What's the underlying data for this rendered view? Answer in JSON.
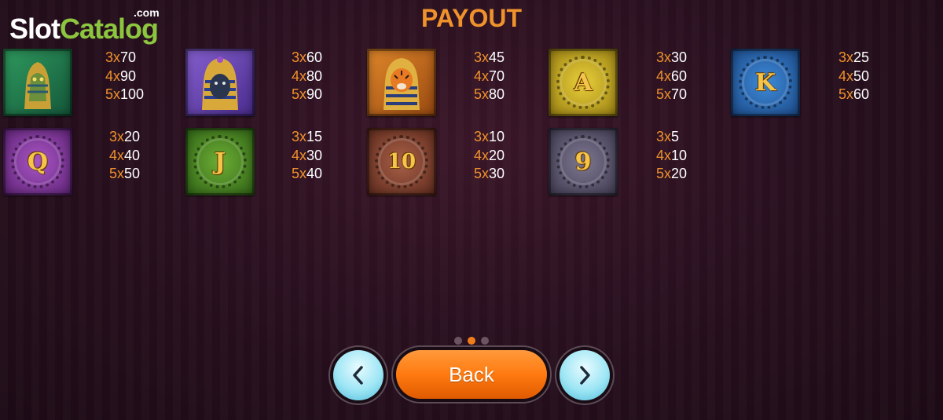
{
  "logo": {
    "slot": "Slot",
    "catalog": "Catalog",
    "com": ".com"
  },
  "title": "PAYOUT",
  "symbols": [
    {
      "name": "reptile-god",
      "letter": "",
      "color": "#1f7a4a",
      "pays": [
        [
          "3x",
          "70"
        ],
        [
          "4x",
          "90"
        ],
        [
          "5x",
          "100"
        ]
      ]
    },
    {
      "name": "gorilla-pharaoh",
      "letter": "",
      "color": "#6a3fb0",
      "pays": [
        [
          "3x",
          "60"
        ],
        [
          "4x",
          "80"
        ],
        [
          "5x",
          "90"
        ]
      ]
    },
    {
      "name": "tiger-pharaoh",
      "letter": "",
      "color": "#c46a1c",
      "pays": [
        [
          "3x",
          "45"
        ],
        [
          "4x",
          "70"
        ],
        [
          "5x",
          "80"
        ]
      ]
    },
    {
      "name": "a",
      "letter": "A",
      "color": "#c8a81f",
      "pays": [
        [
          "3x",
          "30"
        ],
        [
          "4x",
          "60"
        ],
        [
          "5x",
          "70"
        ]
      ]
    },
    {
      "name": "k",
      "letter": "K",
      "color": "#2c6db4",
      "pays": [
        [
          "3x",
          "25"
        ],
        [
          "4x",
          "50"
        ],
        [
          "5x",
          "60"
        ]
      ]
    },
    {
      "name": "q",
      "letter": "Q",
      "color": "#8a3da0",
      "pays": [
        [
          "3x",
          "20"
        ],
        [
          "4x",
          "40"
        ],
        [
          "5x",
          "50"
        ]
      ]
    },
    {
      "name": "j",
      "letter": "J",
      "color": "#4f8f24",
      "pays": [
        [
          "3x",
          "15"
        ],
        [
          "4x",
          "30"
        ],
        [
          "5x",
          "40"
        ]
      ]
    },
    {
      "name": "10",
      "letter": "10",
      "color": "#8a4a34",
      "pays": [
        [
          "3x",
          "10"
        ],
        [
          "4x",
          "20"
        ],
        [
          "5x",
          "30"
        ]
      ]
    },
    {
      "name": "9",
      "letter": "9",
      "color": "#5e5870",
      "pays": [
        [
          "3x",
          "5"
        ],
        [
          "4x",
          "10"
        ],
        [
          "5x",
          "20"
        ]
      ]
    }
  ],
  "pagination": {
    "pages": 3,
    "active": 2
  },
  "nav": {
    "back_label": "Back",
    "prev_icon": "chevron-left-icon",
    "next_icon": "chevron-right-icon"
  },
  "colors": {
    "accent": "#f0922c",
    "button": "#ff7a10",
    "nav_button": "#9ee6f5"
  }
}
